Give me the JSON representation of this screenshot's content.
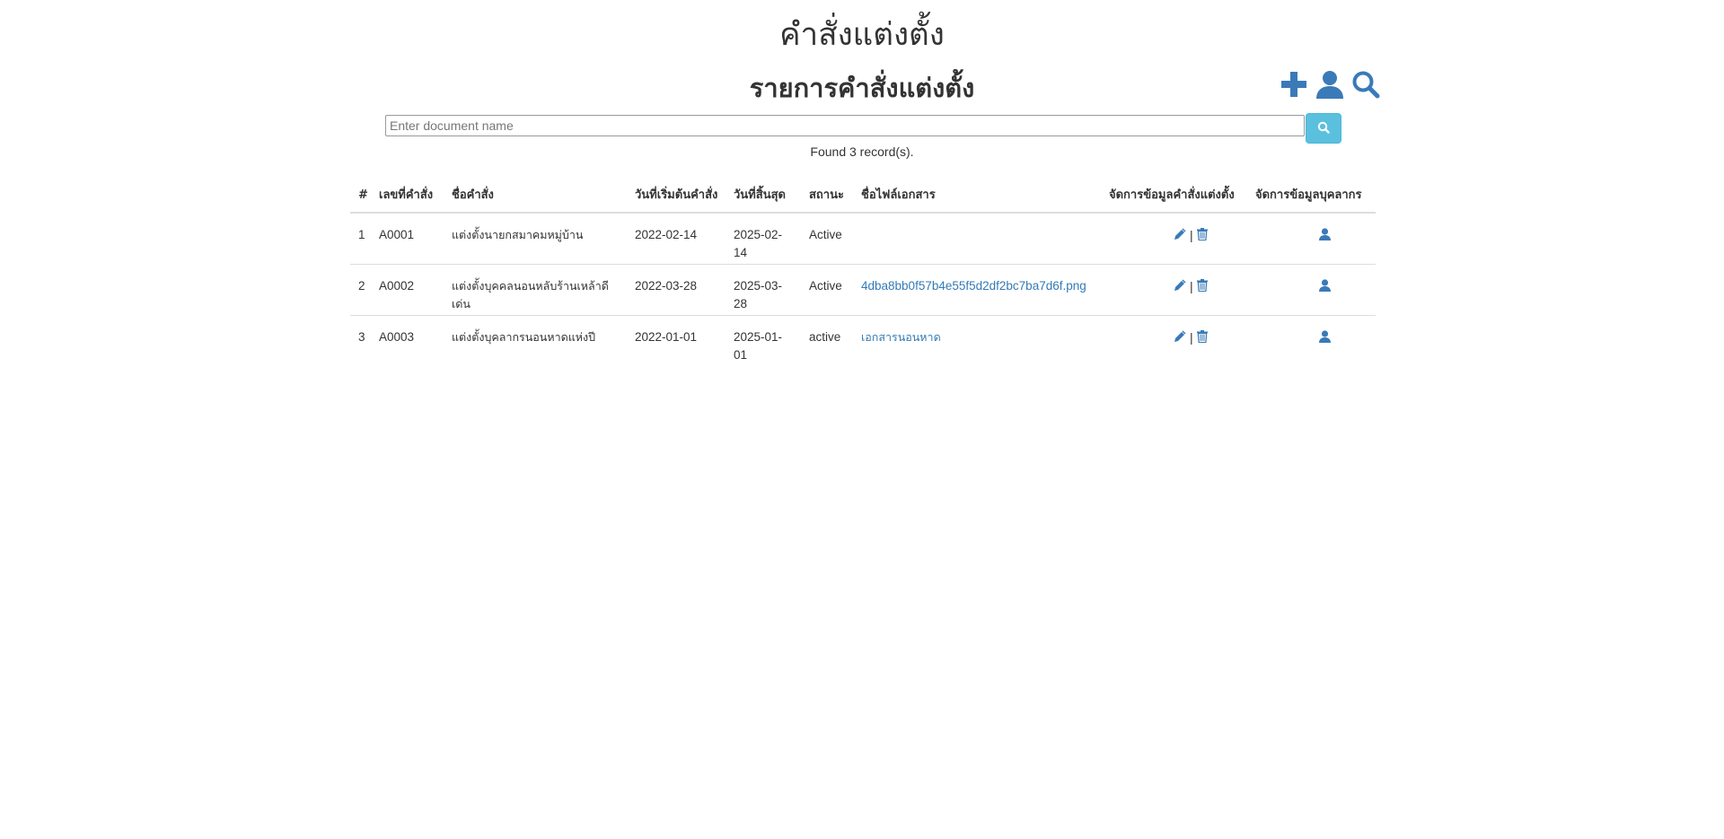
{
  "page": {
    "title": "คำสั่งแต่งตั้ง",
    "subtitle": "รายการคำสั่งแต่งตั้ง"
  },
  "toolbar": {
    "icons": [
      "plus-icon",
      "user-icon",
      "search-icon"
    ],
    "color": "#3a7ab8"
  },
  "search": {
    "placeholder": "Enter document name",
    "value": "",
    "button_color": "#5bc0de"
  },
  "results": {
    "found_text": "Found 3 record(s)."
  },
  "table": {
    "headers": {
      "index": "#",
      "order_no": "เลขที่คำสั่ง",
      "order_name": "ชื่อคำสั่ง",
      "start_date": "วันที่เริ่มต้นคำสั่ง",
      "end_date": "วันที่สิ้นสุด",
      "status": "สถานะ",
      "file_name": "ชื่อไฟล์เอกสาร",
      "manage_order": "จัดการข้อมูลคำสั่งแต่งตั้ง",
      "manage_personnel": "จัดการข้อมูลบุคลากร"
    },
    "rows": [
      {
        "index": "1",
        "order_no": "A0001",
        "order_name": "แต่งตั้งนายกสมาคมหมู่บ้าน",
        "start_date": "2022-02-14",
        "end_date": "2025-02-14",
        "status": "Active",
        "file_name": ""
      },
      {
        "index": "2",
        "order_no": "A0002",
        "order_name": "แต่งตั้งบุคคลนอนหลับร้านเหล้าดีเด่น",
        "start_date": "2022-03-28",
        "end_date": "2025-03-28",
        "status": "Active",
        "file_name": "4dba8bb0f57b4e55f5d2df2bc7ba7d6f.png"
      },
      {
        "index": "3",
        "order_no": "A0003",
        "order_name": "แต่งตั้งบุคลากรนอนหาดแห่งปี",
        "start_date": "2022-01-01",
        "end_date": "2025-01-01",
        "status": "active",
        "file_name": "เอกสารนอนหาด"
      }
    ],
    "action_separator": "|",
    "link_color": "#337ab7"
  }
}
